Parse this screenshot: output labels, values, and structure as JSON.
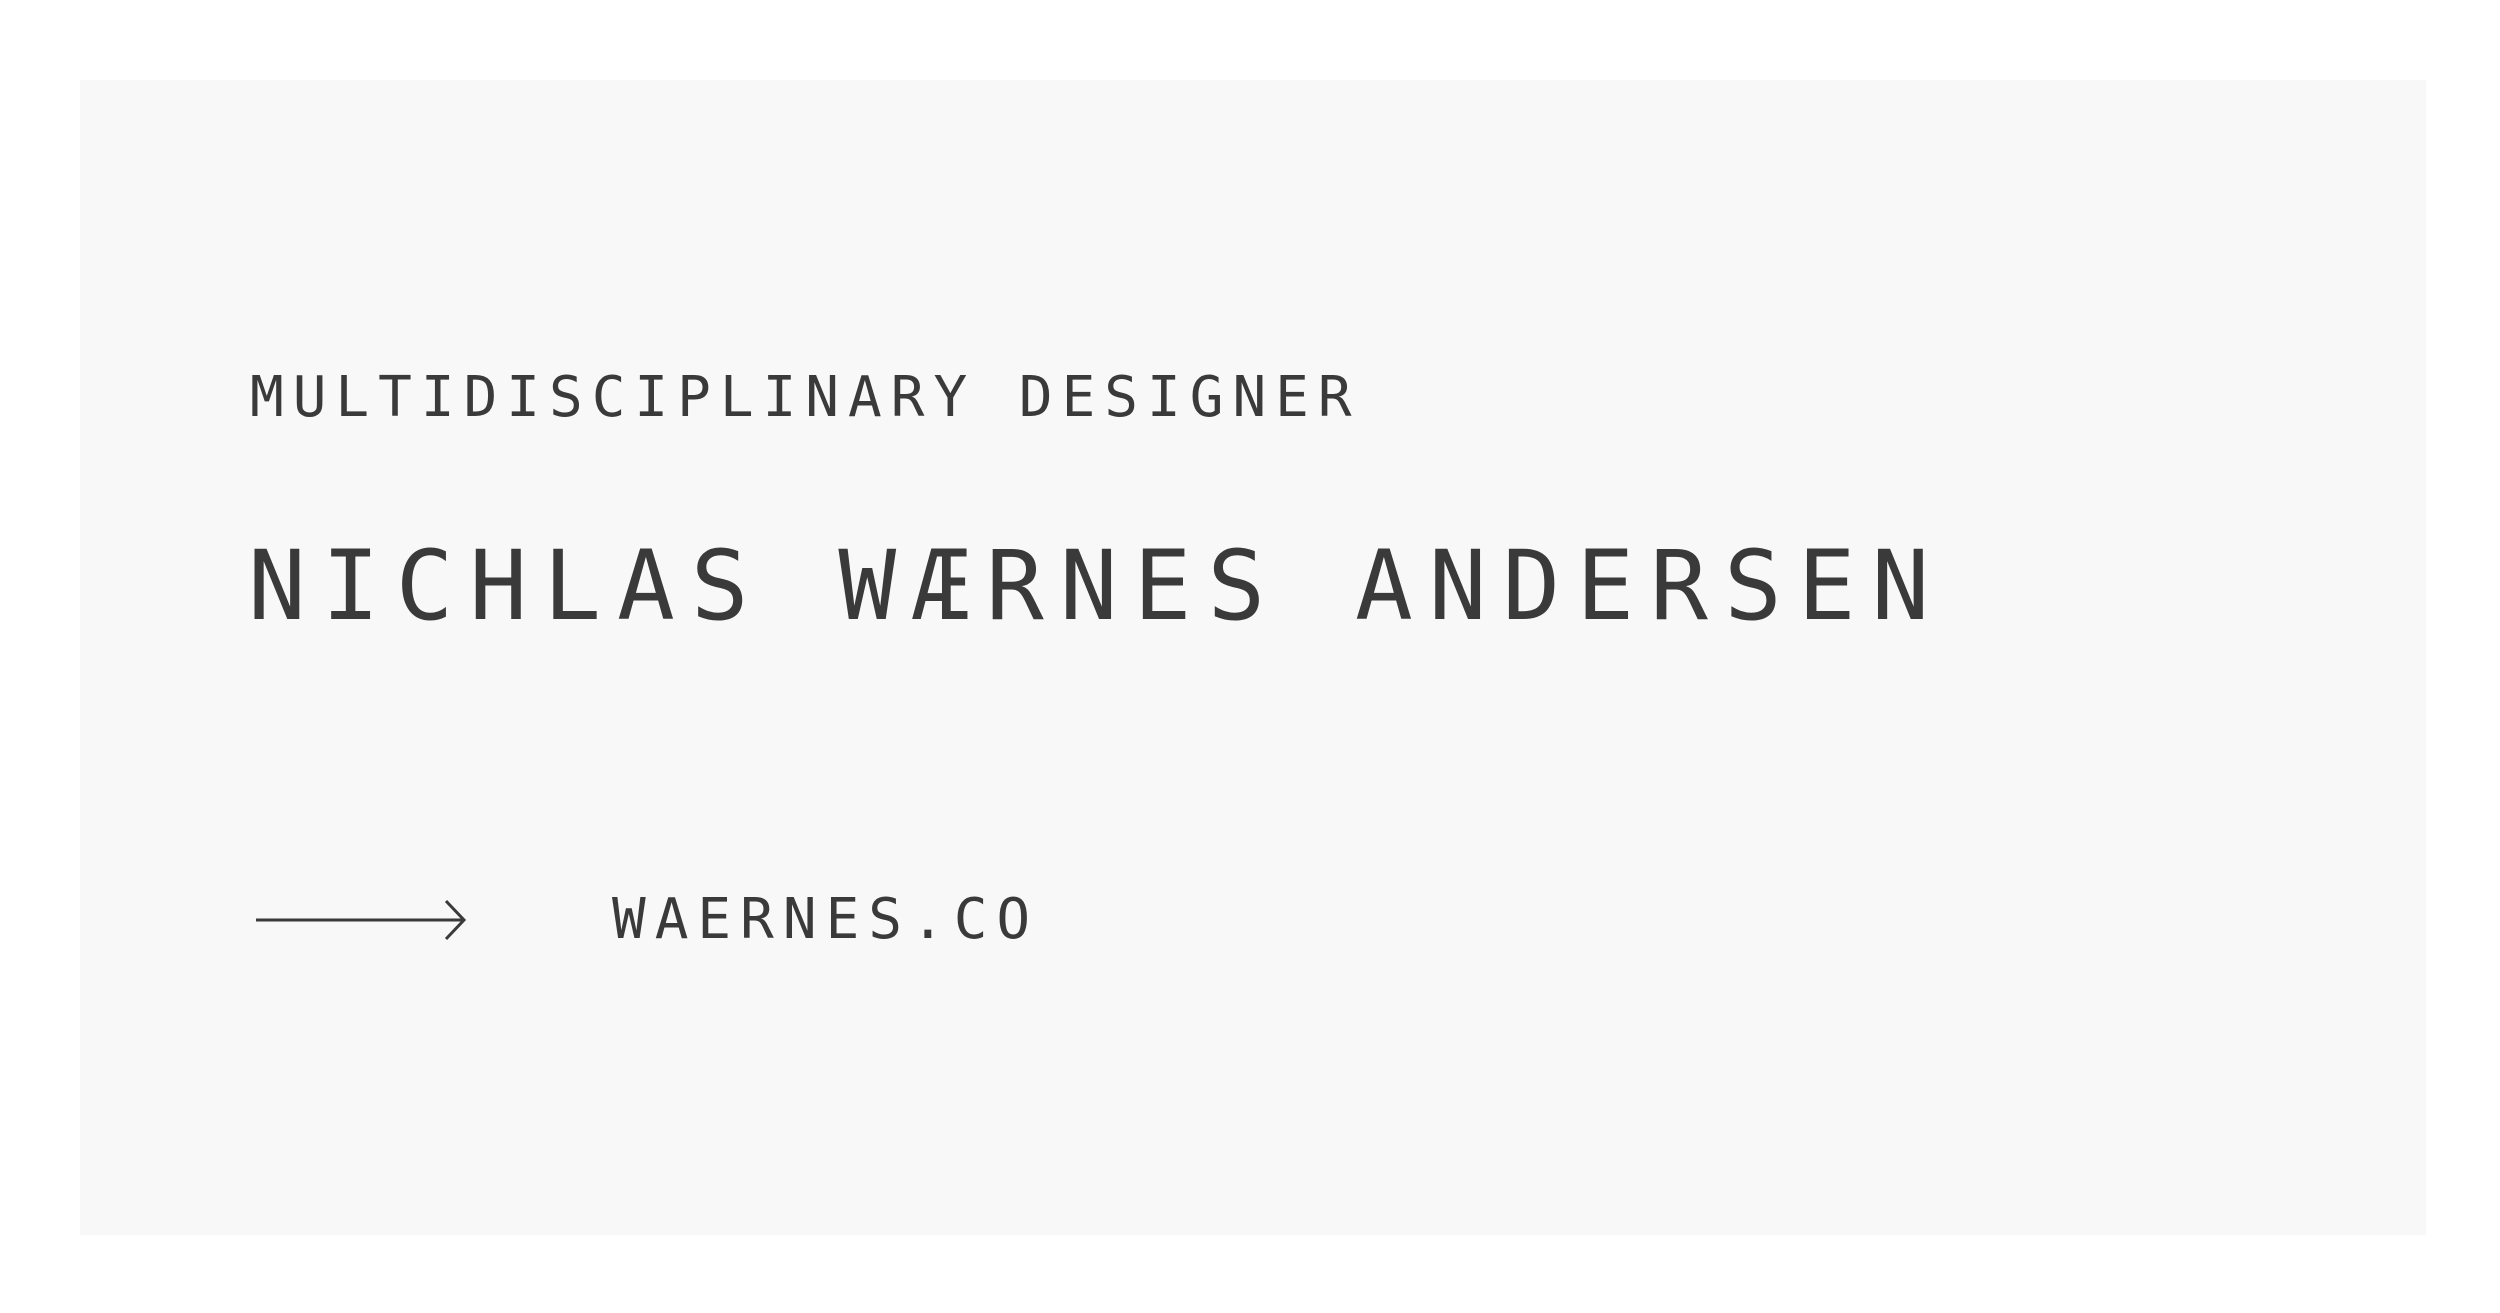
{
  "card": {
    "role": "MULTIDISCIPLINARY DESIGNER",
    "name": "NICHLAS WÆRNES ANDERSEN",
    "link": {
      "icon": "arrow-right-icon",
      "text": "WAERNES.CO"
    }
  },
  "colors": {
    "text": "#3a3a3a",
    "card_background": "#f8f8f8",
    "page_background": "#ffffff"
  }
}
